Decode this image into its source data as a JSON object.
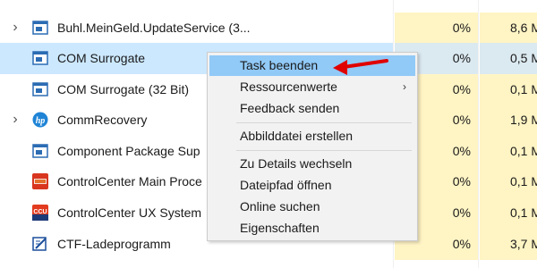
{
  "processes": [
    {
      "name": "Buhl.MeinGeld.UpdateService (3...",
      "icon": "service-window-icon",
      "expandable": true,
      "cpu": "0%",
      "memory": "8,6 M"
    },
    {
      "name": "COM Surrogate",
      "icon": "service-window-icon",
      "expandable": false,
      "cpu": "0%",
      "memory": "0,5 M",
      "selected": true
    },
    {
      "name": "COM Surrogate (32 Bit)",
      "icon": "service-window-icon",
      "expandable": false,
      "cpu": "0%",
      "memory": "0,1 M"
    },
    {
      "name": "CommRecovery",
      "icon": "hp-logo-icon",
      "expandable": true,
      "cpu": "0%",
      "memory": "1,9 M"
    },
    {
      "name": "Component Package Sup",
      "icon": "service-window-icon",
      "expandable": false,
      "cpu": "0%",
      "memory": "0,1 M"
    },
    {
      "name": "ControlCenter Main Proce",
      "icon": "controlcenter-icon",
      "expandable": false,
      "cpu": "0%",
      "memory": "0,1 M"
    },
    {
      "name": "ControlCenter UX System",
      "icon": "ccu-icon",
      "expandable": false,
      "cpu": "0%",
      "memory": "0,1 M"
    },
    {
      "name": "CTF-Ladeprogramm",
      "icon": "ctf-loader-icon",
      "expandable": false,
      "cpu": "0%",
      "memory": "3,7 M"
    }
  ],
  "context_menu": {
    "items": [
      {
        "label": "Task beenden",
        "highlighted": true
      },
      {
        "label": "Ressourcenwerte",
        "submenu": true
      },
      {
        "label": "Feedback senden"
      },
      {
        "label": "Abbilddatei erstellen"
      },
      {
        "label": "Zu Details wechseln"
      },
      {
        "label": "Dateipfad öffnen"
      },
      {
        "label": "Online suchen"
      },
      {
        "label": "Eigenschaften"
      }
    ]
  },
  "colors": {
    "selection": "#cce8ff",
    "menu_highlight": "#91c9f7",
    "cpu_heat": "#fff4c4",
    "annotation_arrow": "#e00000"
  }
}
